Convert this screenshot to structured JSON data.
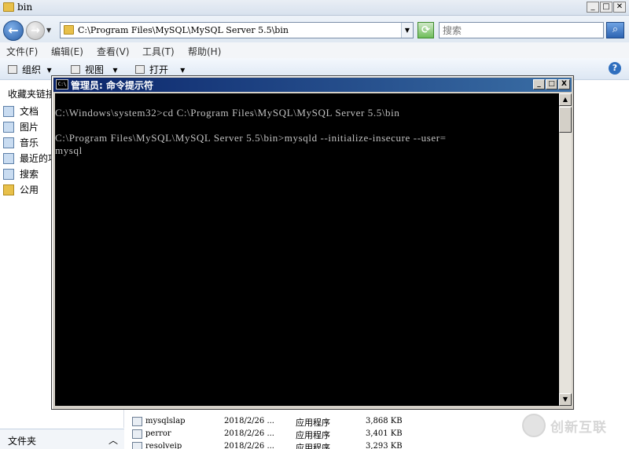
{
  "explorer": {
    "title": "bin",
    "window_buttons": [
      "_",
      "□",
      "✕"
    ],
    "address_path": "C:\\Program Files\\MySQL\\MySQL Server 5.5\\bin",
    "search_placeholder": "搜索",
    "menu": [
      "文件(F)",
      "编辑(E)",
      "查看(V)",
      "工具(T)",
      "帮助(H)"
    ],
    "toolbar": {
      "organize": "组织",
      "views": "视图",
      "open": "打开"
    },
    "favorites_header": "收藏夹链接",
    "favorites": [
      "文档",
      "图片",
      "音乐",
      "最近的项目",
      "搜索",
      "公用"
    ],
    "folders_label": "文件夹",
    "files": [
      {
        "name": "mysqlslap",
        "date": "2018/2/26 ...",
        "type": "应用程序",
        "size": "3,868 KB"
      },
      {
        "name": "perror",
        "date": "2018/2/26 ...",
        "type": "应用程序",
        "size": "3,401 KB"
      },
      {
        "name": "resolveip",
        "date": "2018/2/26 ...",
        "type": "应用程序",
        "size": "3,293 KB"
      }
    ]
  },
  "cmd": {
    "title": "管理员: 命令提示符",
    "icon_text": "C:\\",
    "buttons": [
      "_",
      "□",
      "X"
    ],
    "lines": [
      "C:\\Windows\\system32>cd C:\\Program Files\\MySQL\\MySQL Server 5.5\\bin",
      "C:\\Program Files\\MySQL\\MySQL Server 5.5\\bin>mysqld --initialize-insecure --user=",
      "mysql"
    ]
  },
  "watermark": "创新互联"
}
